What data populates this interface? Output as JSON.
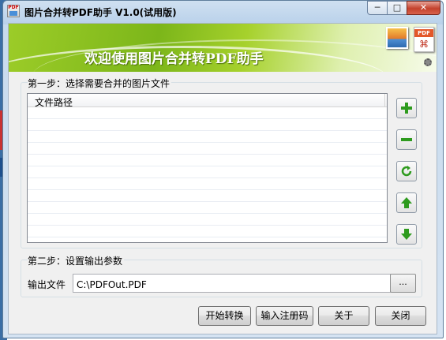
{
  "window": {
    "title": "图片合并转PDF助手 V1.0(试用版)",
    "controls": {
      "minimize": "─",
      "maximize": "□",
      "close": "✕"
    }
  },
  "banner": {
    "text": "欢迎使用图片合并转PDF助手",
    "pdf_tag": "PDF"
  },
  "step1": {
    "legend": "第一步：选择需要合并的图片文件",
    "list": {
      "columns": [
        "文件路径"
      ],
      "rows": []
    },
    "buttons": [
      {
        "name": "add-file-button",
        "icon": "plus-icon"
      },
      {
        "name": "remove-file-button",
        "icon": "minus-icon"
      },
      {
        "name": "refresh-button",
        "icon": "refresh-icon"
      },
      {
        "name": "move-up-button",
        "icon": "arrow-up-icon"
      },
      {
        "name": "move-down-button",
        "icon": "arrow-down-icon"
      }
    ]
  },
  "step2": {
    "legend": "第二步：设置输出参数",
    "output_label": "输出文件",
    "output_value": "C:\\PDFOut.PDF",
    "browse_label": "..."
  },
  "actions": {
    "start": "开始转换",
    "register": "输入注册码",
    "about": "关于",
    "close": "关闭"
  },
  "colors": {
    "accent_green": "#2e9b1e",
    "banner_green": "#8ac21e",
    "close_red": "#c4412c"
  }
}
